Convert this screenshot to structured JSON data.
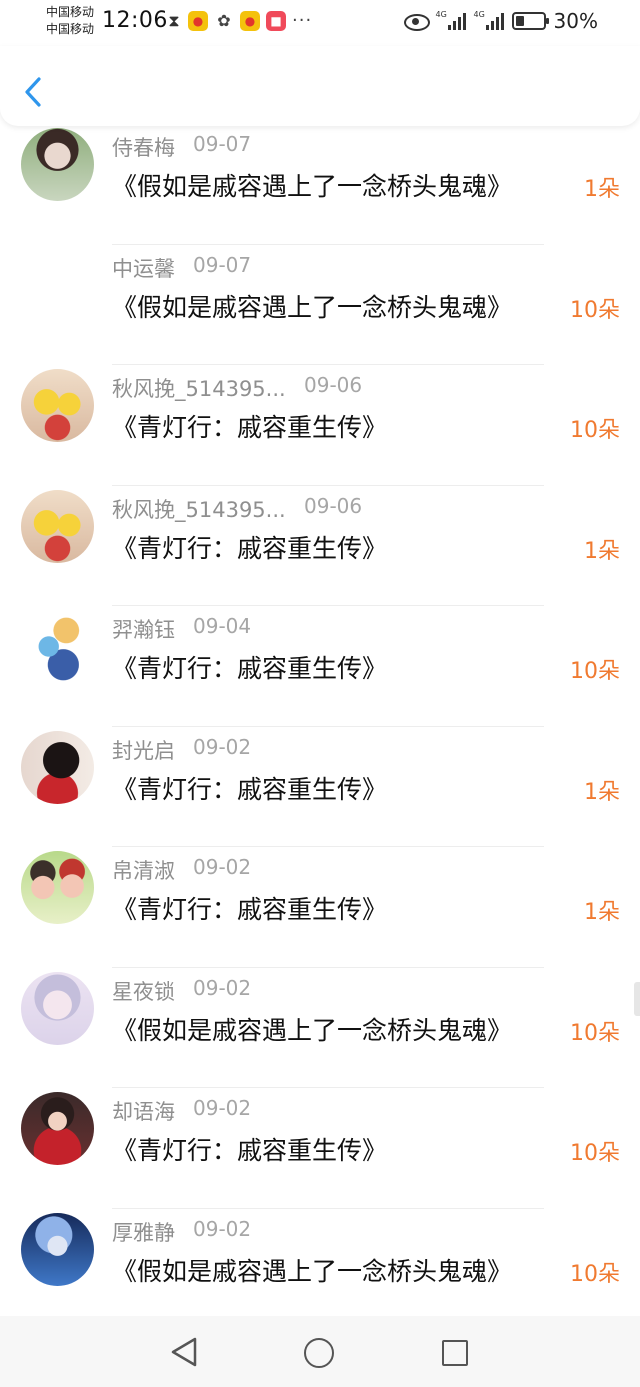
{
  "status_bar": {
    "carrier_1": "中国移动",
    "carrier_2": "中国移动",
    "time": "12:06",
    "network_label_1": "4G",
    "network_label_2": "4G",
    "battery_percent": "30%",
    "battery_level": 0.3,
    "more_dots": "···"
  },
  "header": {
    "back_icon": "chevron-left-icon"
  },
  "items": [
    {
      "name": "侍春梅",
      "date": "09-07",
      "book": "《假如是戚容遇上了一念桥头鬼魂》",
      "count": "1朵",
      "has_avatar": true
    },
    {
      "name": "中运馨",
      "date": "09-07",
      "book": "《假如是戚容遇上了一念桥头鬼魂》",
      "count": "10朵",
      "has_avatar": false
    },
    {
      "name": "秋风挽_514395...",
      "date": "09-06",
      "book": "《青灯行：戚容重生传》",
      "count": "10朵",
      "has_avatar": true
    },
    {
      "name": "秋风挽_514395...",
      "date": "09-06",
      "book": "《青灯行：戚容重生传》",
      "count": "1朵",
      "has_avatar": true
    },
    {
      "name": "羿瀚钰",
      "date": "09-04",
      "book": "《青灯行：戚容重生传》",
      "count": "10朵",
      "has_avatar": true
    },
    {
      "name": "封光启",
      "date": "09-02",
      "book": "《青灯行：戚容重生传》",
      "count": "1朵",
      "has_avatar": true
    },
    {
      "name": "帛清淑",
      "date": "09-02",
      "book": "《青灯行：戚容重生传》",
      "count": "1朵",
      "has_avatar": true
    },
    {
      "name": "星夜锁",
      "date": "09-02",
      "book": "《假如是戚容遇上了一念桥头鬼魂》",
      "count": "10朵",
      "has_avatar": true
    },
    {
      "name": "却语海",
      "date": "09-02",
      "book": "《青灯行：戚容重生传》",
      "count": "10朵",
      "has_avatar": true
    },
    {
      "name": "厚雅静",
      "date": "09-02",
      "book": "《假如是戚容遇上了一念桥头鬼魂》",
      "count": "10朵",
      "has_avatar": true
    }
  ],
  "colors": {
    "accent_count": "#f07a30",
    "name_gray": "#8f8f8f",
    "date_gray": "#a6a6a6"
  }
}
